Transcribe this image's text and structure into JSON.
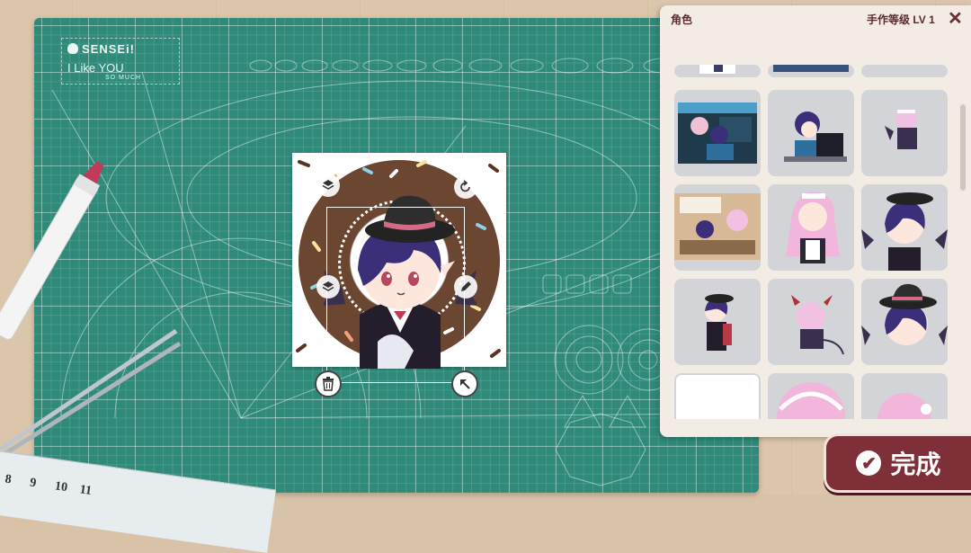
{
  "mat": {
    "brand_line1": "SENSEi!",
    "brand_line2": "I Like YOU",
    "brand_line3": "SO MUCH"
  },
  "sticker_tools": {
    "layer_up_icon": "layers-icon",
    "rotate_icon": "rotate-icon",
    "edit_icon": "pencil-icon",
    "delete_icon": "trash-icon",
    "resize_icon": "resize-arrow-icon"
  },
  "ruler": {
    "numbers": [
      "8",
      "9",
      "10",
      "11"
    ]
  },
  "panel": {
    "title": "角色",
    "level": "手作等级 LV 1",
    "close_icon": "close-icon",
    "items": [
      {
        "id": "partial-1"
      },
      {
        "id": "partial-2"
      },
      {
        "id": "partial-3"
      },
      {
        "id": "screen-scene"
      },
      {
        "id": "desk-boy"
      },
      {
        "id": "small-pink-girl"
      },
      {
        "id": "group-scene"
      },
      {
        "id": "maid-girl"
      },
      {
        "id": "bat-boy-bust"
      },
      {
        "id": "bat-boy-full"
      },
      {
        "id": "devil-girl"
      },
      {
        "id": "bat-boy-hat"
      },
      {
        "id": "blank"
      },
      {
        "id": "pink-girl-a"
      },
      {
        "id": "pink-girl-b"
      }
    ]
  },
  "done_button": {
    "label": "完成",
    "icon": "check-icon"
  },
  "colors": {
    "mat": "#2f8a7a",
    "panel": "#f3ece4",
    "accent": "#7e2f37"
  }
}
